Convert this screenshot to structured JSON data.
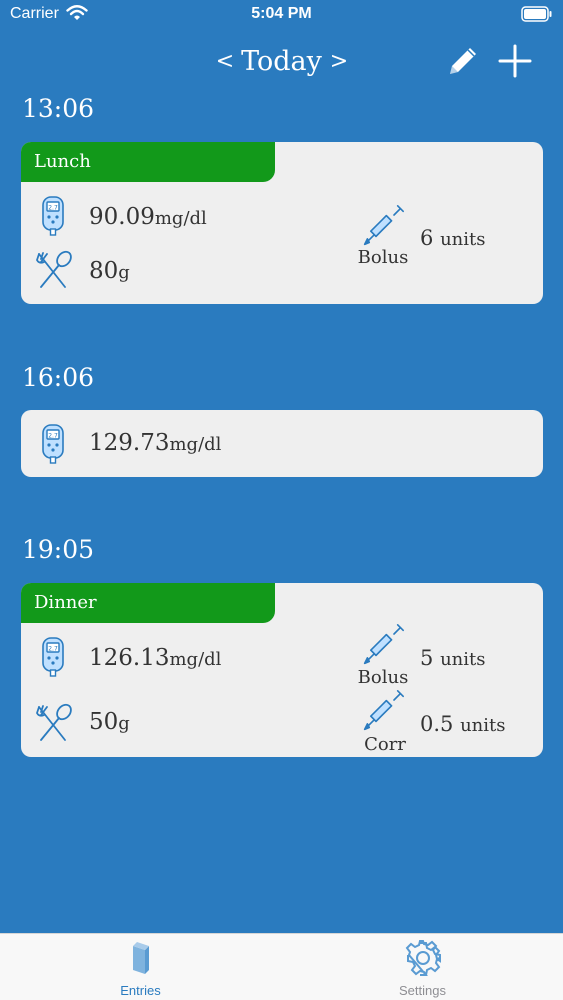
{
  "status_bar": {
    "carrier": "Carrier",
    "time": "5:04 PM"
  },
  "header": {
    "prev": "<",
    "date": "Today",
    "next": ">"
  },
  "entries": [
    {
      "time": "13:06",
      "meal": "Lunch",
      "glucose": {
        "value": "90.09",
        "unit": "mg/dl"
      },
      "carbs": {
        "value": "80",
        "unit": "g"
      },
      "insulin": [
        {
          "label": "Bolus",
          "value": "6",
          "unit": "units"
        }
      ]
    },
    {
      "time": "16:06",
      "glucose": {
        "value": "129.73",
        "unit": "mg/dl"
      }
    },
    {
      "time": "19:05",
      "meal": "Dinner",
      "glucose": {
        "value": "126.13",
        "unit": "mg/dl"
      },
      "carbs": {
        "value": "50",
        "unit": "g"
      },
      "insulin": [
        {
          "label": "Bolus",
          "value": "5",
          "unit": "units"
        },
        {
          "label": "Corr",
          "value": "0.5",
          "unit": "units"
        }
      ]
    }
  ],
  "tabs": [
    {
      "label": "Entries",
      "active": true
    },
    {
      "label": "Settings",
      "active": false
    }
  ],
  "colors": {
    "background": "#2a7bbf",
    "meal_tag": "#12991a",
    "card": "#efefef",
    "icon": "#3d8fd4"
  }
}
